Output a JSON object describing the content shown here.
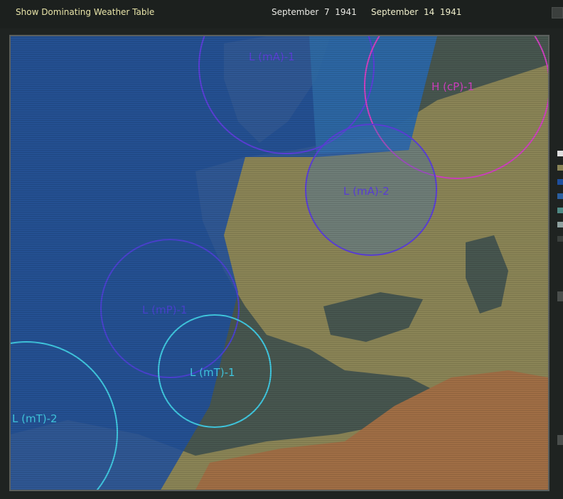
{
  "header": {
    "toggle_label": "Show Dominating Weather Table",
    "date_from": "September  7  1941",
    "date_to": "September  14  1941"
  },
  "map": {
    "colors": {
      "sea": "#47564f",
      "land": "#8a8456",
      "desert": "#a06e45",
      "maritime_polar": "#1e4f9e",
      "maritime_arctic": "#2a5fa0",
      "continental_polar": "#4a6b7a"
    },
    "systems": [
      {
        "name": "L (mA)-1",
        "kind": "mA",
        "color": "#5b3fd8"
      },
      {
        "name": "H (cP)-1",
        "kind": "cP",
        "color": "#d040c0"
      },
      {
        "name": "L (mA)-2",
        "kind": "mA",
        "color": "#5b3fd8"
      },
      {
        "name": "L (mP)-1",
        "kind": "mP",
        "color": "#4a42d0"
      },
      {
        "name": "L (mT)-1",
        "kind": "mT",
        "color": "#40c8e0"
      },
      {
        "name": "L (mT)-2",
        "kind": "mT",
        "color": "#40c8e0"
      }
    ]
  },
  "legend": {
    "checkmark_icon": "check-icon",
    "swatches": [
      "#8a8456",
      "#1e4f9e",
      "#2a5fa0",
      "#4f8a85",
      "#8fa1a0",
      "#3a3f3c"
    ]
  }
}
